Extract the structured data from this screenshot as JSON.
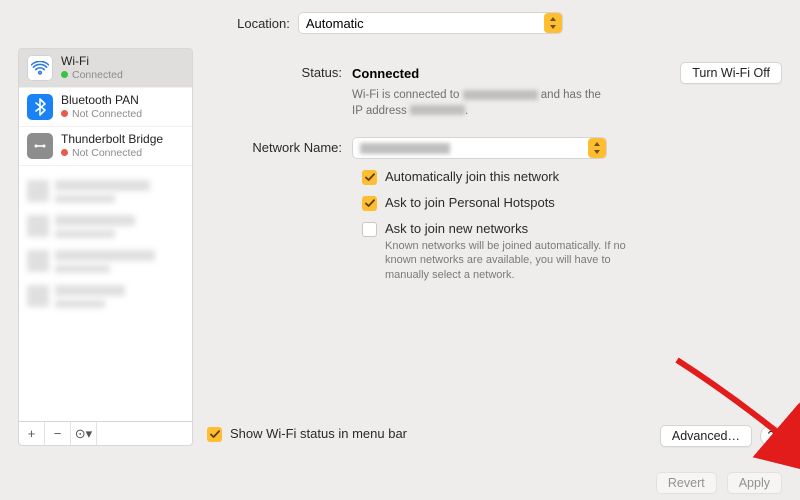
{
  "location": {
    "label": "Location:",
    "value": "Automatic"
  },
  "sidebar": {
    "services": [
      {
        "name": "Wi-Fi",
        "status": "Connected",
        "dot": "green"
      },
      {
        "name": "Bluetooth PAN",
        "status": "Not Connected",
        "dot": "red"
      },
      {
        "name": "Thunderbolt Bridge",
        "status": "Not Connected",
        "dot": "red"
      }
    ],
    "toolbar": {
      "add": "+",
      "remove": "−",
      "menu": "⊙▾"
    }
  },
  "status": {
    "label": "Status:",
    "value": "Connected",
    "turn_off": "Turn Wi-Fi Off",
    "desc_prefix": "Wi-Fi is connected to ",
    "desc_mid": " and has the IP address "
  },
  "network": {
    "label": "Network Name:"
  },
  "options": {
    "auto_join": "Automatically join this network",
    "ask_hotspot": "Ask to join Personal Hotspots",
    "ask_new": "Ask to join new networks",
    "ask_new_help": "Known networks will be joined automatically. If no known networks are available, you will have to manually select a network."
  },
  "menubar": {
    "label": "Show Wi-Fi status in menu bar"
  },
  "buttons": {
    "advanced": "Advanced…",
    "help": "?",
    "revert": "Revert",
    "apply": "Apply"
  },
  "colors": {
    "accent": "#ffbe32"
  }
}
